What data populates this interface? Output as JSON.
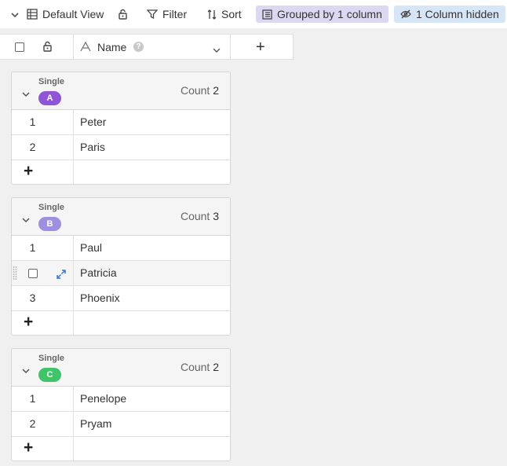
{
  "toolbar": {
    "view_label": "Default View",
    "filter_label": "Filter",
    "sort_label": "Sort",
    "grouped_label": "Grouped by 1 column",
    "hidden_label": "1 Column hidden",
    "grouped_color": "#dcd8f2",
    "hidden_color": "#d7e6f7"
  },
  "header": {
    "column_name": "Name",
    "help_glyph": "?",
    "add_column_glyph": "+"
  },
  "groups": [
    {
      "field": "Single",
      "option": "A",
      "option_color": "#8e56d6",
      "count_label": "Count",
      "count": "2",
      "rows": [
        {
          "index": "1",
          "value": "Peter"
        },
        {
          "index": "2",
          "value": "Paris"
        }
      ],
      "add_glyph": "+"
    },
    {
      "field": "Single",
      "option": "B",
      "option_color": "#a08fe0",
      "count_label": "Count",
      "count": "3",
      "rows": [
        {
          "index": "1",
          "value": "Paul"
        },
        {
          "index": "",
          "value": "Patricia",
          "hovered": true
        },
        {
          "index": "3",
          "value": "Phoenix"
        }
      ],
      "add_glyph": "+"
    },
    {
      "field": "Single",
      "option": "C",
      "option_color": "#3fc46a",
      "count_label": "Count",
      "count": "2",
      "rows": [
        {
          "index": "1",
          "value": "Penelope"
        },
        {
          "index": "2",
          "value": "Pryam"
        }
      ],
      "add_glyph": "+"
    }
  ]
}
